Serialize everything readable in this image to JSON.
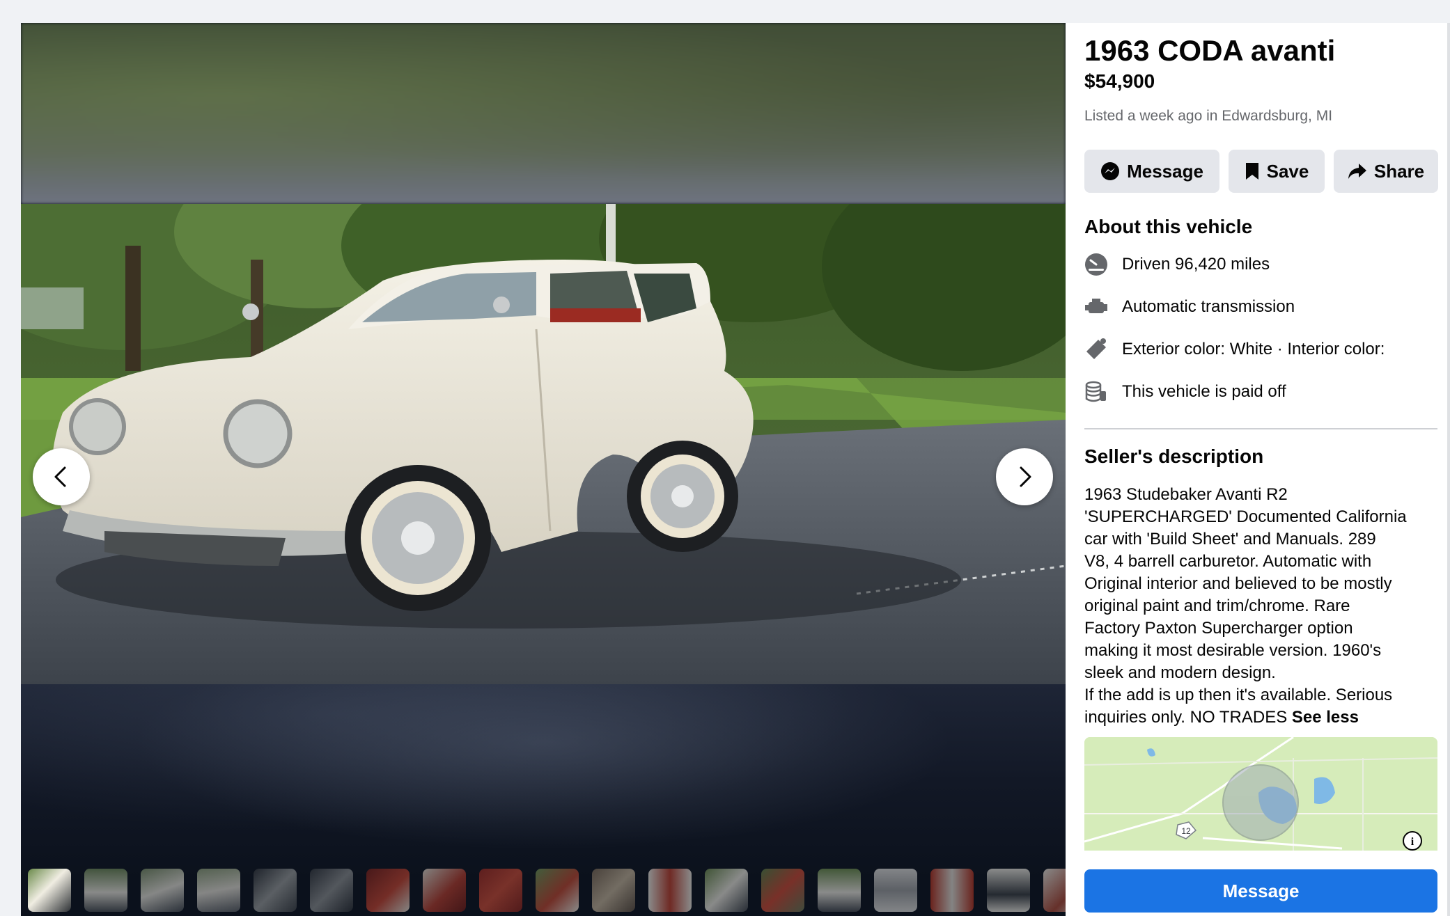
{
  "listing": {
    "title": "1963 CODA avanti",
    "price": "$54,900",
    "listed": "Listed a week ago in Edwardsburg, MI"
  },
  "actions": {
    "message_label": "Message",
    "save_label": "Save",
    "share_label": "Share"
  },
  "about": {
    "heading": "About this vehicle",
    "items": [
      {
        "icon": "speedometer-icon",
        "text": "Driven 96,420 miles"
      },
      {
        "icon": "engine-icon",
        "text": "Automatic transmission"
      },
      {
        "icon": "paint-icon",
        "text": "Exterior color: White · Interior color:"
      },
      {
        "icon": "coins-icon",
        "text": "This vehicle is paid off"
      }
    ]
  },
  "seller": {
    "heading": "Seller's description",
    "lines": [
      "1963 Studebaker Avanti R2",
      "'SUPERCHARGED' Documented California",
      "car with 'Build Sheet' and Manuals. 289",
      "V8, 4 barrell carburetor. Automatic with",
      "Original interior and believed to be mostly",
      "original paint and trim/chrome.  Rare",
      "Factory Paxton Supercharger option",
      "making it most desirable version. 1960's",
      "sleek and modern design.",
      "If the add is up then it's available. Serious"
    ],
    "last_line": "inquiries only. NO TRADES",
    "see_less": "See less"
  },
  "map": {
    "route_marker": "12",
    "info_label": "i"
  },
  "footer": {
    "message_label": "Message"
  },
  "colors": {
    "accent": "#1b74e4",
    "button_bg": "#e4e6eb",
    "car_body": "#ebe7da"
  }
}
